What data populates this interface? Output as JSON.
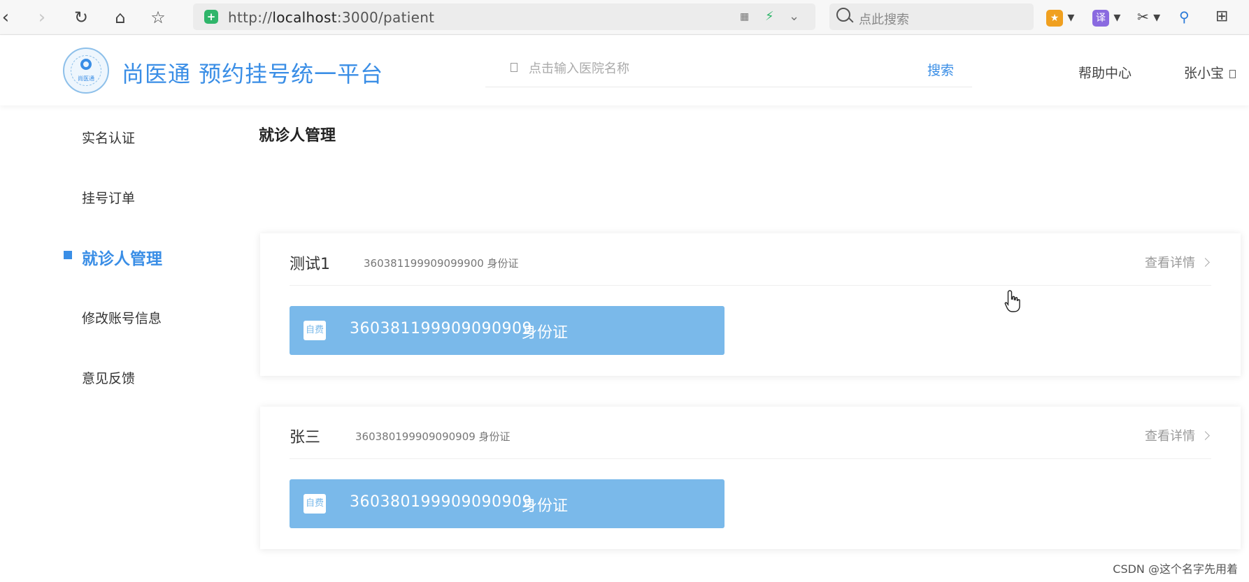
{
  "browser": {
    "url_prefix": "http://",
    "url_host": "localhost",
    "url_rest": ":3000/patient",
    "search_placeholder": "点此搜索",
    "translate_badge": "译"
  },
  "site": {
    "logo_text": "尚医通",
    "brand": "尚医通 预约挂号统一平台",
    "search_placeholder": "点击输入医院名称",
    "search_button": "搜索",
    "help": "帮助中心",
    "user": "张小宝"
  },
  "sidebar": {
    "items": [
      {
        "label": "实名认证"
      },
      {
        "label": "挂号订单"
      },
      {
        "label": "就诊人管理"
      },
      {
        "label": "修改账号信息"
      },
      {
        "label": "意见反馈"
      }
    ]
  },
  "main": {
    "title": "就诊人管理",
    "patients": [
      {
        "name": "测试1",
        "id_line": "360381199909099900 身份证",
        "detail": "查看详情",
        "card_tag": "自费",
        "card_number": "360381199909090909",
        "card_type": "身份证"
      },
      {
        "name": "张三",
        "id_line": "360380199909090909 身份证",
        "detail": "查看详情",
        "card_tag": "自费",
        "card_number": "360380199909090909",
        "card_type": "身份证"
      }
    ]
  },
  "watermark": "CSDN @这个名字先用着",
  "colors": {
    "accent": "#3a8ee6",
    "id_card": "#7ab9ea"
  }
}
